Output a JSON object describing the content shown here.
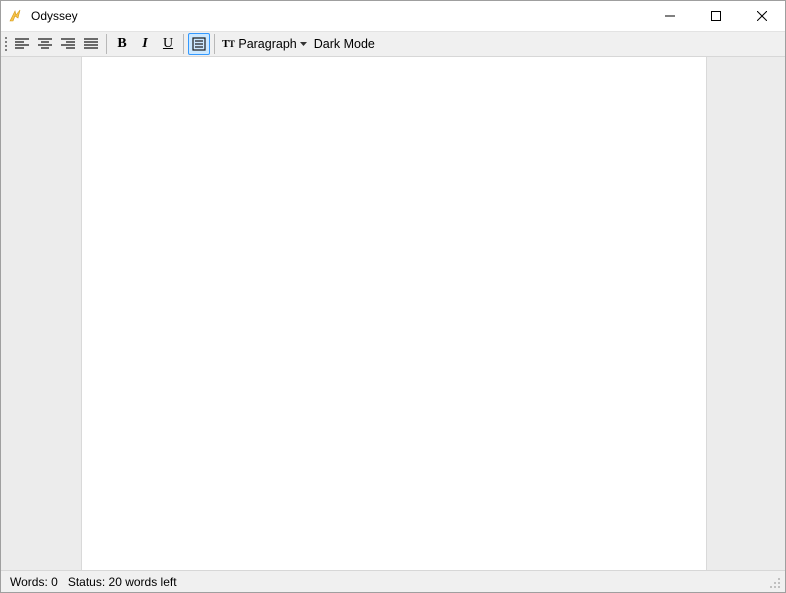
{
  "window": {
    "title": "Odyssey"
  },
  "toolbar": {
    "style_dropdown_label": "Paragraph",
    "dark_mode_label": "Dark Mode"
  },
  "status": {
    "words_label": "Words:",
    "words_value": "0",
    "status_label": "Status:",
    "status_value": "20 words left"
  }
}
